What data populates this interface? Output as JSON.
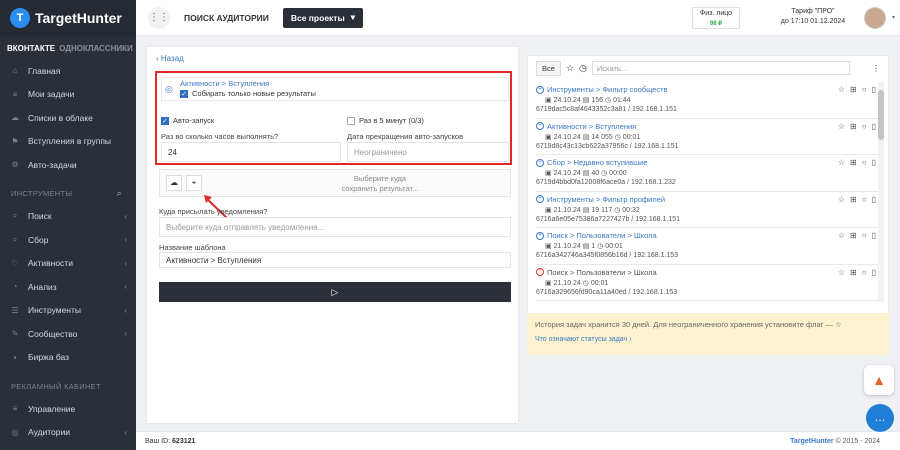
{
  "app": {
    "logo_text": "TargetHunter",
    "logo_mark": "T"
  },
  "sidebar": {
    "net_active": "ВКОНТАКТЕ",
    "net_other": "ОДНОКЛАССНИКИ",
    "top_items": [
      {
        "label": "Главная",
        "icon": "home-icon"
      },
      {
        "label": "Мои задачи",
        "icon": "tasks-icon"
      },
      {
        "label": "Списки в облаке",
        "icon": "cloud-icon"
      },
      {
        "label": "Вступления в группы",
        "icon": "group-icon"
      },
      {
        "label": "Авто-задачи",
        "icon": "gears-icon"
      }
    ],
    "tools_header": "ИНСТРУМЕНТЫ",
    "tool_items": [
      {
        "label": "Поиск"
      },
      {
        "label": "Сбор"
      },
      {
        "label": "Активности"
      },
      {
        "label": "Анализ"
      },
      {
        "label": "Инструменты"
      },
      {
        "label": "Сообщество"
      },
      {
        "label": "Биржа баз"
      }
    ],
    "ads_header": "РЕКЛАМНЫЙ КАБИНЕТ",
    "ads_items": [
      {
        "label": "Управление"
      },
      {
        "label": "Аудитории"
      }
    ]
  },
  "topbar": {
    "title": "ПОИСК АУДИТОРИИ",
    "projects": "Все проекты",
    "acct_type": "Физ. лицо",
    "balance": "98 ₽",
    "tariff_line1": "Тариф \"ПРО\"",
    "tariff_line2": "до 17:10 01.12.2024"
  },
  "form": {
    "back": "Назад",
    "section_link": "Активности > Вступления",
    "collect_new": "Собирать только новые результаты",
    "autorun": "Авто-запуск",
    "every5": "Раз в 5 минут (0/3)",
    "hours_label": "Раз во сколько часов выполнять?",
    "hours_value": "24",
    "stop_label": "Дата прекращения авто-запусков",
    "stop_placeholder": "Неограничено",
    "upload_hint1": "Выберите куда",
    "upload_hint2": "сохранить результат...",
    "notify_label": "Куда присылать уведомления?",
    "notify_placeholder": "Выберите куда отправлять уведомления...",
    "template_label": "Название шаблона",
    "template_value": "Активности > Вступления"
  },
  "history": {
    "all": "Все",
    "search_placeholder": "Искать...",
    "rows": [
      {
        "path": "Инструменты > Фильтр сообществ",
        "date": "24.10.24",
        "count": "156",
        "dur": "01:44",
        "id": "6719dac5c8af4643352c3a81 / 192.168.1.151",
        "status": "ok"
      },
      {
        "path": "Активности > Вступления",
        "date": "24.10.24",
        "count": "14 055",
        "dur": "00:01",
        "id": "6719d8c43c13cb622a37956c / 192.168.1.151",
        "status": "ok"
      },
      {
        "path": "Сбор > Недавно вступившие",
        "date": "24.10.24",
        "count": "40",
        "dur": "00:00",
        "id": "6719d4bbd0fa12008f6ace0a / 192.168.1.232",
        "status": "ok"
      },
      {
        "path": "Инструменты > Фильтр профилей",
        "date": "21.10.24",
        "count": "19 117",
        "dur": "00:32",
        "id": "6716a6e05e75386a7227427b / 192.168.1.151",
        "status": "ok"
      },
      {
        "path": "Поиск > Пользователи > Школа",
        "date": "21.10.24",
        "count": "1",
        "dur": "00:01",
        "id": "6716a342746a345f0856b16d / 192.168.1.153",
        "status": "ok"
      },
      {
        "path": "Поиск > Пользователи > Школа",
        "date": "21.10.24",
        "count": "",
        "dur": "00:01",
        "id": "6716a329656fd90ca11a40ed / 192.168.1.153",
        "status": "err"
      }
    ],
    "note": "История задач хранится 30 дней. Для неограниченного хранения установите флаг —",
    "note_link": "Что означают статусы задач"
  },
  "footer": {
    "id_label": "Ваш ID:",
    "id_value": "623121",
    "brand": "TargetHunter",
    "copy": "© 2015 - 2024"
  }
}
